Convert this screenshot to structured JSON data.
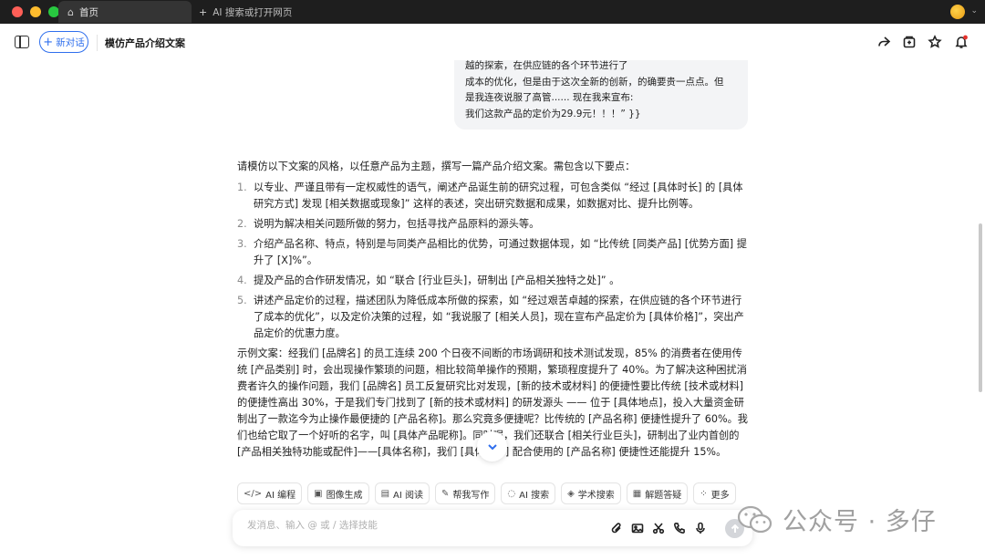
{
  "window": {
    "active_tab": "首页",
    "new_tab": "AI 搜索或打开网页"
  },
  "header": {
    "new_chat_label": "新对话",
    "title": "模仿产品介绍文案"
  },
  "user_bubble": {
    "lines": [
      "越的探索，在供应链的各个环节进行了",
      "成本的优化，但是由于这次全新的创新，的确要贵一点点。但",
      "是我连夜说服了高管...... 现在我来宣布:",
      "我们这款产品的定价为29.9元！！！” }}"
    ]
  },
  "answer": {
    "intro": "请模仿以下文案的风格，以任意产品为主题，撰写一篇产品介绍文案。需包含以下要点：",
    "points": [
      {
        "num": "1.",
        "text": "以专业、严谨且带有一定权威性的语气，阐述产品诞生前的研究过程，可包含类似 “经过 [具体时长] 的 [具体研究方式] 发现 [相关数据或现象]” 这样的表述，突出研究数据和成果，如数据对比、提升比例等。"
      },
      {
        "num": "2.",
        "text": "说明为解决相关问题所做的努力，包括寻找产品原料的源头等。"
      },
      {
        "num": "3.",
        "text": "介绍产品名称、特点，特别是与同类产品相比的优势，可通过数据体现，如 “比传统 [同类产品] [优势方面] 提升了 [X]%”。"
      },
      {
        "num": "4.",
        "text": "提及产品的合作研发情况，如 “联合 [行业巨头]，研制出 [产品相关独特之处]” 。"
      },
      {
        "num": "5.",
        "text": "讲述产品定价的过程，描述团队为降低成本所做的探索，如 “经过艰苦卓越的探索，在供应链的各个环节进行了成本的优化”，以及定价决策的过程，如 “我说服了 [相关人员]，现在宣布产品定价为 [具体价格]”，突出产品定价的优惠力度。"
      }
    ],
    "example": "示例文案：经我们 [品牌名] 的员工连续 200 个日夜不间断的市场调研和技术测试发现，85% 的消费者在使用传统 [产品类别] 时，会出现操作繁琐的问题，相比较简单操作的预期，繁琐程度提升了 40%。为了解决这种困扰消费者许久的操作问题，我们 [品牌名] 员工反复研究比对发现，[新的技术或材料] 的便捷性要比传统 [技术或材料] 的便捷性高出 30%，于是我们专门找到了 [新的技术或材料] 的研发源头 —— 位于 [具体地点]，投入大量资金研制出了一款迄今为止操作最便捷的 [产品名称]。那么究竟多便捷呢？比传统的 [产品名称] 便捷性提升了 60%。我们也给它取了一个好听的名字，叫 [具体产品昵称]。同时呢，我们还联合 [相关行业巨头]，研制出了业内首创的 [产品相关独特功能或配件]——[具体名称]，我们 [具体名称] 配合使用的 [产品名称] 便捷性还能提升 15%。"
  },
  "tools": [
    {
      "icon": "code-icon",
      "glyph": "</>",
      "label": "AI 编程"
    },
    {
      "icon": "image-icon",
      "glyph": "▣",
      "label": "图像生成"
    },
    {
      "icon": "read-icon",
      "glyph": "▤",
      "label": "AI 阅读"
    },
    {
      "icon": "pen-icon",
      "glyph": "✎",
      "label": "帮我写作"
    },
    {
      "icon": "search-icon",
      "glyph": "◌",
      "label": "AI 搜索"
    },
    {
      "icon": "academic-icon",
      "glyph": "◈",
      "label": "学术搜索"
    },
    {
      "icon": "solve-icon",
      "glyph": "▦",
      "label": "解题答疑"
    },
    {
      "icon": "more-icon",
      "glyph": "⁘",
      "label": "更多"
    }
  ],
  "input": {
    "placeholder": "发消息、输入 @ 或 / 选择技能"
  },
  "watermark": {
    "text": "公众号 · 多仔"
  },
  "colors": {
    "accent": "#2f6fed",
    "bubble_bg": "#f3f4f6",
    "titlebar_bg": "#1e1e1e"
  }
}
